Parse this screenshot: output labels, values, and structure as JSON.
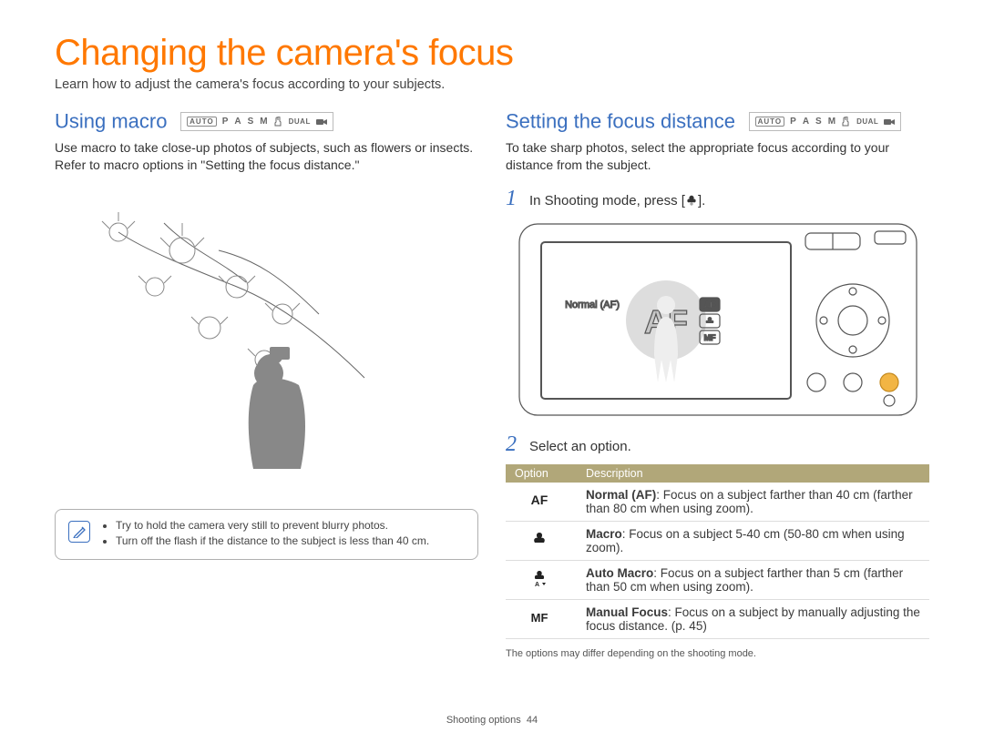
{
  "page_title": "Changing the camera's focus",
  "intro": "Learn how to adjust the camera's focus according to your subjects.",
  "mode_row": {
    "auto": "AUTO",
    "p": "P",
    "a": "A",
    "s": "S",
    "m": "M",
    "dual": "DUAL"
  },
  "left": {
    "heading": "Using macro",
    "text": "Use macro to take close-up photos of subjects, such as flowers or insects. Refer to macro options in \"Setting the focus distance.\"",
    "tips": [
      "Try to hold the camera very still to prevent blurry photos.",
      "Turn off the flash if the distance to the subject is less than 40 cm."
    ]
  },
  "right": {
    "heading": "Setting the focus distance",
    "text": "To take sharp photos, select the appropriate focus according to your distance from the subject.",
    "step1": "In Shooting mode, press [",
    "step1_end": "].",
    "screen_label": "Normal (AF)",
    "step2": "Select an option.",
    "table_headers": {
      "option": "Option",
      "description": "Description"
    },
    "rows": [
      {
        "icon": "af",
        "title": "Normal (AF)",
        "text": ": Focus on a subject farther than 40 cm (farther than 80 cm when using zoom)."
      },
      {
        "icon": "tulip",
        "title": "Macro",
        "text": ": Focus on a subject 5-40 cm (50-80 cm when using zoom)."
      },
      {
        "icon": "tulip-a",
        "title": "Auto Macro",
        "text": ": Focus on a subject farther than 5 cm (farther than 50 cm when using zoom)."
      },
      {
        "icon": "mf",
        "title": "Manual Focus",
        "text": ": Focus on a subject by manually adjusting the focus distance. (p. 45)"
      }
    ],
    "disclaimer": "The options may differ depending on the shooting mode."
  },
  "footer": {
    "section": "Shooting options",
    "page_num": "44"
  }
}
